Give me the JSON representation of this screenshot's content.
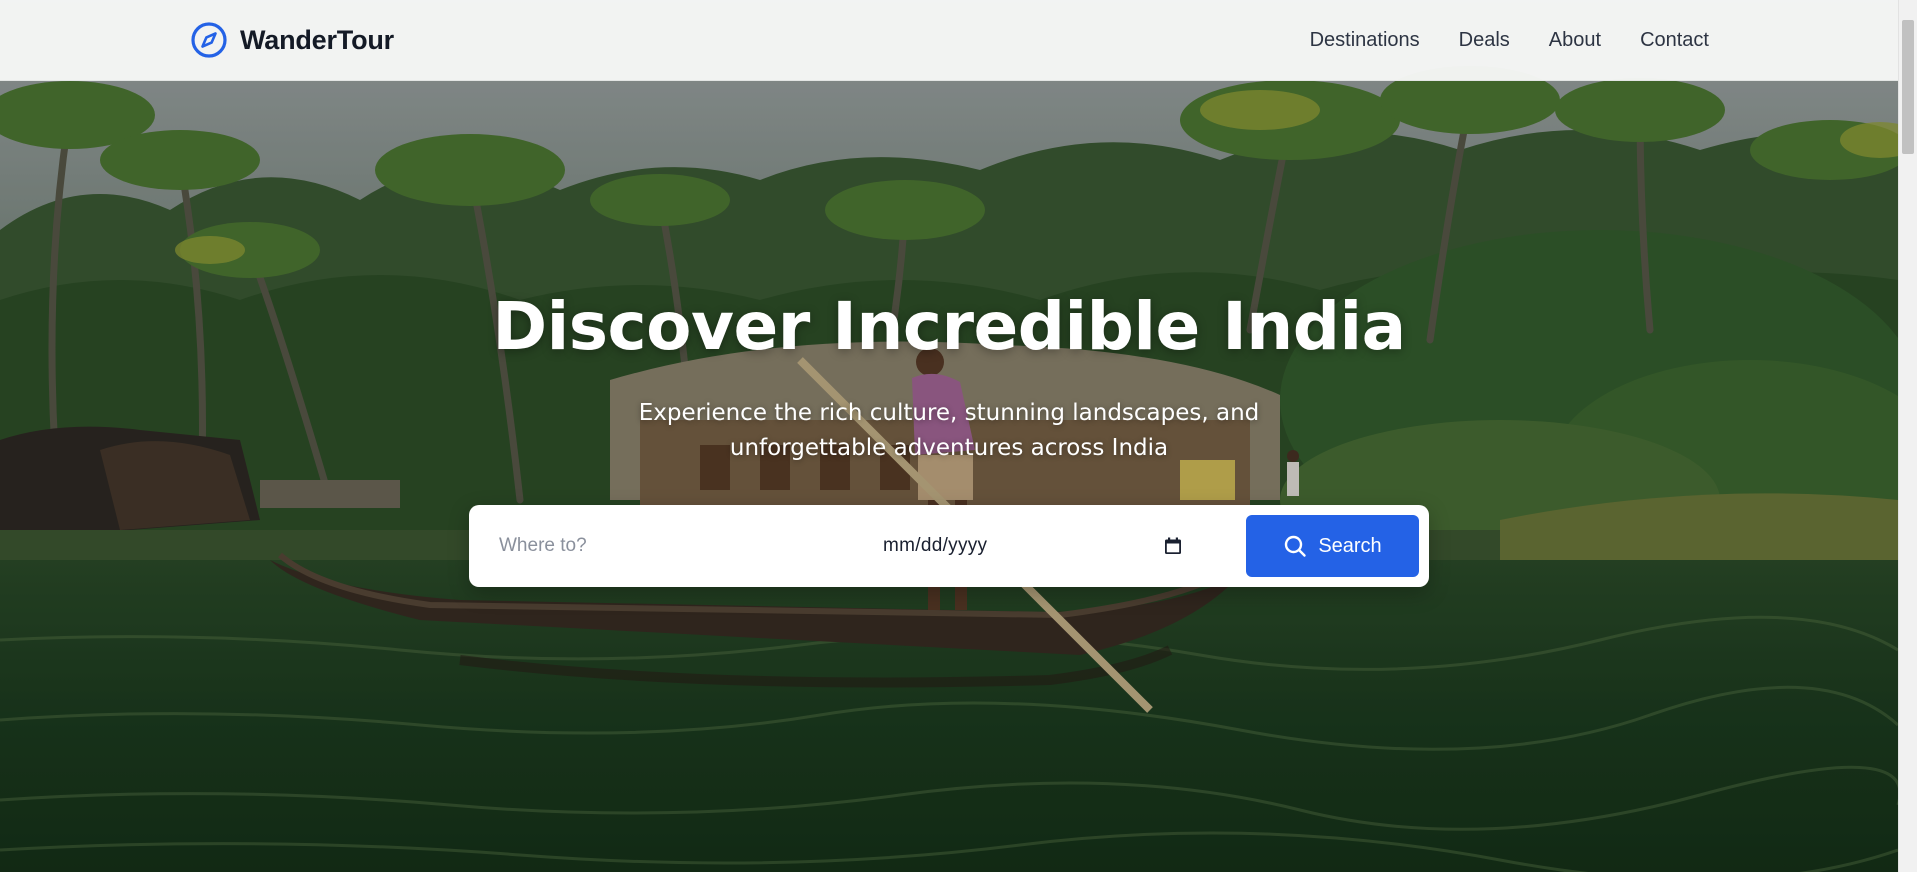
{
  "brand": {
    "name": "WanderTour",
    "icon": "compass-icon",
    "accent": "#2462e6"
  },
  "nav": {
    "links": [
      "Destinations",
      "Deals",
      "About",
      "Contact"
    ]
  },
  "hero": {
    "title": "Discover Incredible India",
    "subtitle": "Experience the rich culture, stunning landscapes, and unforgettable adventures across India",
    "background": "photo of a man poling a wooden canoe on Kerala backwaters with houseboats and palm trees"
  },
  "search": {
    "destination_placeholder": "Where to?",
    "destination_value": "",
    "date_placeholder": "mm/dd/yyyy",
    "date_icon": "calendar-icon",
    "button_label": "Search",
    "button_icon": "search-icon",
    "button_color": "#2462e6"
  }
}
